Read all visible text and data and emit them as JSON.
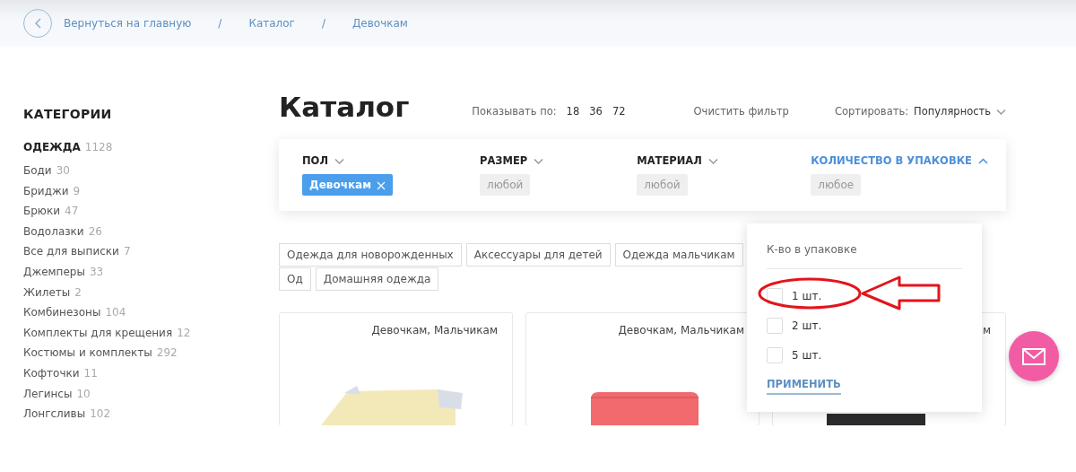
{
  "breadcrumbs": {
    "back_label": "Вернуться на главную",
    "items": [
      {
        "separator": "/",
        "label": "Каталог"
      },
      {
        "separator": "/",
        "label": "Девочкам"
      }
    ]
  },
  "sidebar": {
    "title": "КАТЕГОРИИ",
    "group": {
      "label": "ОДЕЖДА",
      "count": "1128"
    },
    "items": [
      {
        "label": "Боди",
        "count": "30"
      },
      {
        "label": "Бриджи",
        "count": "9"
      },
      {
        "label": "Брюки",
        "count": "47"
      },
      {
        "label": "Водолазки",
        "count": "26"
      },
      {
        "label": "Все для выписки",
        "count": "7"
      },
      {
        "label": "Джемперы",
        "count": "33"
      },
      {
        "label": "Жилеты",
        "count": "2"
      },
      {
        "label": "Комбинезоны",
        "count": "104"
      },
      {
        "label": "Комплекты для крещения",
        "count": "12"
      },
      {
        "label": "Костюмы и комплекты",
        "count": "292"
      },
      {
        "label": "Кофточки",
        "count": "11"
      },
      {
        "label": "Легинсы",
        "count": "10"
      },
      {
        "label": "Лонгсливы",
        "count": "102"
      }
    ]
  },
  "catalog": {
    "title": "Каталог",
    "per_page_label": "Показывать по:",
    "per_page_options": [
      "18",
      "36",
      "72"
    ],
    "clear_filter": "Очистить фильтр",
    "sort_label": "Сортировать:",
    "sort_value": "Популярность"
  },
  "filters": [
    {
      "label": "ПОЛ",
      "expanded": false,
      "chip": {
        "text": "Девочкам",
        "selected": true
      }
    },
    {
      "label": "РАЗМЕР",
      "expanded": false,
      "chip": {
        "text": "любой",
        "selected": false
      }
    },
    {
      "label": "МАТЕРИАЛ",
      "expanded": false,
      "chip": {
        "text": "любой",
        "selected": false
      }
    },
    {
      "label": "КОЛИЧЕСТВО В УПАКОВКЕ",
      "expanded": true,
      "chip": {
        "text": "любое",
        "selected": false
      }
    }
  ],
  "category_tags": [
    "Одежда для новорожденных",
    "Аксессуары для детей",
    "Одежда мальчикам",
    "Од",
    "Домашняя одежда"
  ],
  "products": [
    {
      "tags": "Девочкам, Мальчикам"
    },
    {
      "tags": "Девочкам, Мальчикам"
    },
    {
      "tags": "м"
    }
  ],
  "dropdown": {
    "title": "К-во в упаковке",
    "options": [
      {
        "label": "1 шт.",
        "checked": false
      },
      {
        "label": "2 шт.",
        "checked": false
      },
      {
        "label": "5 шт.",
        "checked": false
      }
    ],
    "apply": "ПРИМЕНИТЬ"
  },
  "annotation": {
    "ellipse": true,
    "arrow": true
  }
}
